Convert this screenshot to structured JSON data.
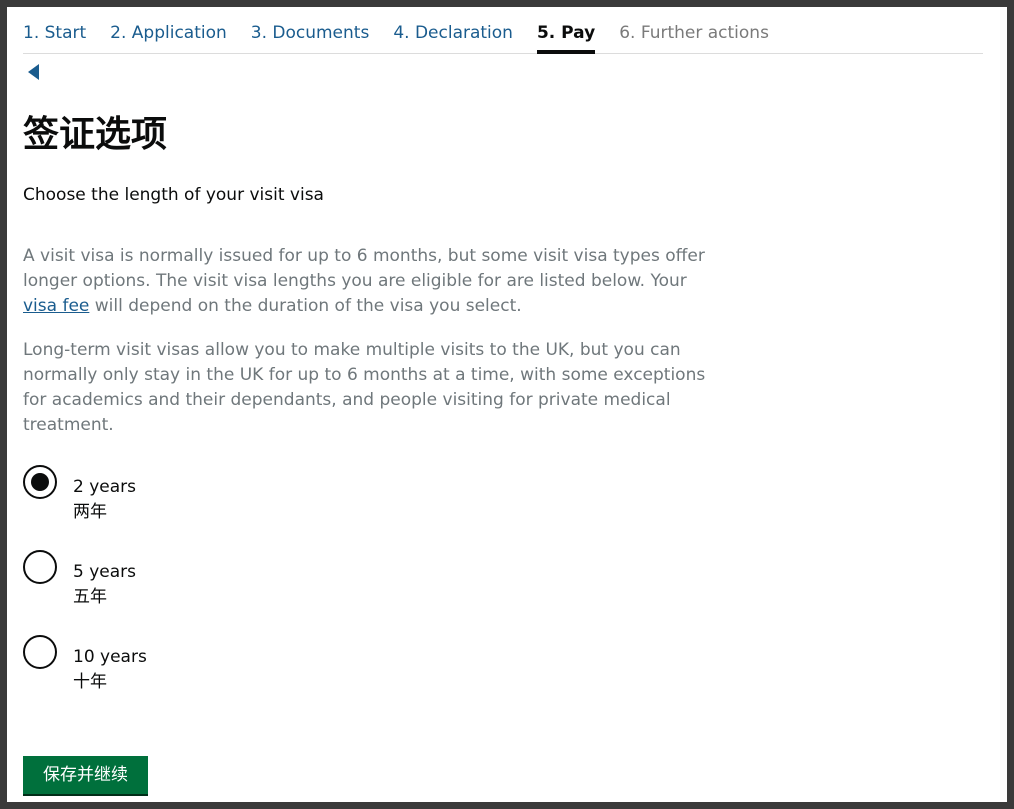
{
  "steps": [
    {
      "label": "1. Start"
    },
    {
      "label": "2. Application"
    },
    {
      "label": "3. Documents"
    },
    {
      "label": "4. Declaration"
    },
    {
      "label": "5. Pay"
    },
    {
      "label": "6. Further actions"
    }
  ],
  "current_step": "5. Pay",
  "back_icon": "triangle-left-icon",
  "page": {
    "title": "签证选项",
    "lead": "Choose the length of your visit visa",
    "p1_before": "A visit visa is normally issued for up to 6 months, but some visit visa types offer longer options. The visit visa lengths you are eligible for are listed below. Your ",
    "p1_link": "visa fee",
    "p1_after": " will depend on the duration of the visa you select.",
    "p2": "Long-term visit visas allow you to make multiple visits to the UK, but you can normally only stay in the UK for up to 6 months at a time, with some exceptions for academics and their dependants, and people visiting for private medical treatment."
  },
  "options": [
    {
      "label": "2 years",
      "sub": "两年",
      "checked": true
    },
    {
      "label": "5 years",
      "sub": "五年",
      "checked": false
    },
    {
      "label": "10 years",
      "sub": "十年",
      "checked": false
    }
  ],
  "submit_label": "保存并继续",
  "colors": {
    "link": "#1a5c8e",
    "button": "#00703c",
    "muted_text": "#6f777b"
  }
}
